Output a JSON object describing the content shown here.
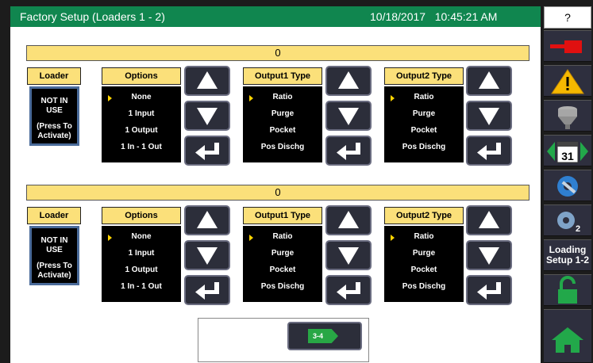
{
  "header": {
    "title": "Factory Setup (Loaders 1 - 2)",
    "datetime": "10/18/2017   10:45:21 AM"
  },
  "help_label": "?",
  "sidebar": {
    "loading_setup_label": "Loading Setup 1-2"
  },
  "sections": [
    {
      "value": "0",
      "loader_header": "Loader",
      "status_lines": [
        "NOT IN",
        "USE",
        "(Press To",
        "Activate)"
      ],
      "options_header": "Options",
      "options": [
        "None",
        "1 Input",
        "1 Output",
        "1 In - 1 Out"
      ],
      "output1_header": "Output1 Type",
      "output1": [
        "Ratio",
        "Purge",
        "Pocket",
        "Pos Dischg"
      ],
      "output2_header": "Output2 Type",
      "output2": [
        "Ratio",
        "Purge",
        "Pocket",
        "Pos Dischg"
      ]
    },
    {
      "value": "0",
      "loader_header": "Loader",
      "status_lines": [
        "NOT IN",
        "USE",
        "(Press To",
        "Activate)"
      ],
      "options_header": "Options",
      "options": [
        "None",
        "1 Input",
        "1 Output",
        "1 In - 1 Out"
      ],
      "output1_header": "Output1 Type",
      "output1": [
        "Ratio",
        "Purge",
        "Pocket",
        "Pos Dischg"
      ],
      "output2_header": "Output2 Type",
      "output2": [
        "Ratio",
        "Purge",
        "Pocket",
        "Pos Dischg"
      ]
    }
  ],
  "next_page_label": "3-4",
  "colors": {
    "title_green": "#10864f",
    "header_yellow": "#fbe07a",
    "button_dark": "#2c2e3a",
    "sidebar_dark": "#2e2f3e"
  }
}
